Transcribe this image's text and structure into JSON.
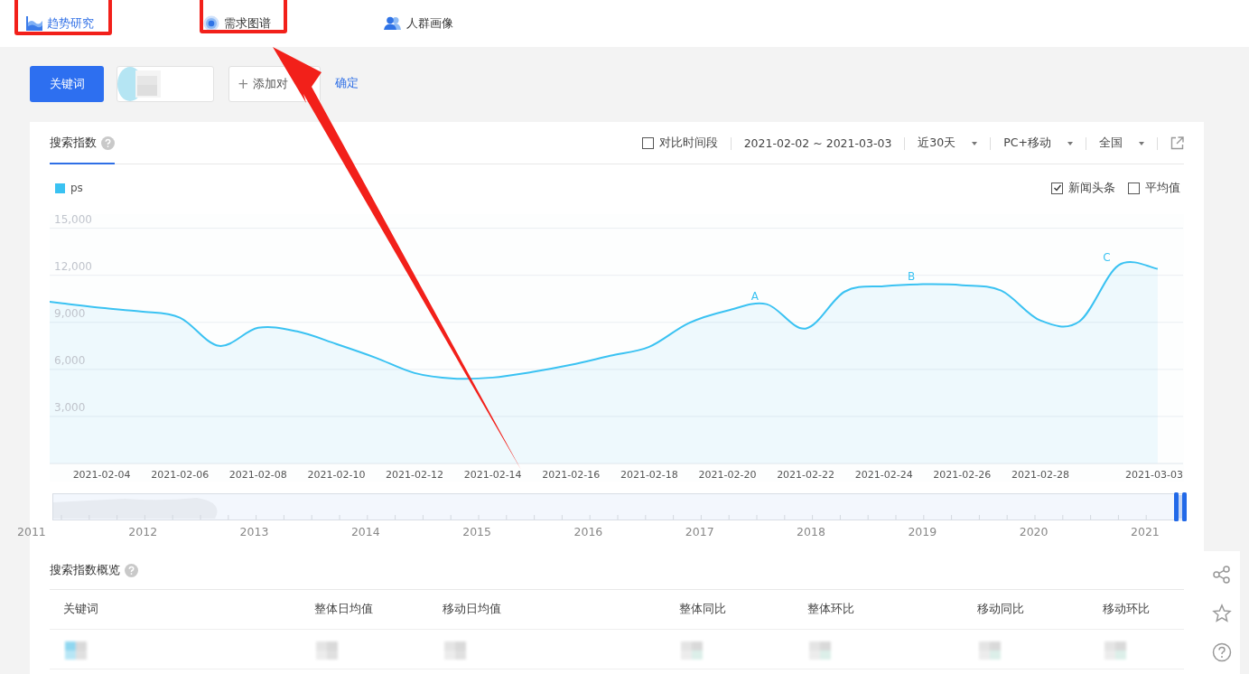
{
  "nav_tabs": [
    {
      "label": "趋势研究",
      "kind": "wave",
      "selected": true,
      "highlighted": true
    },
    {
      "label": "需求图谱",
      "kind": "target",
      "selected": false,
      "highlighted": true
    },
    {
      "label": "人群画像",
      "kind": "people",
      "selected": false,
      "highlighted": false
    }
  ],
  "keyword_bar": {
    "keyword_button": "关键词",
    "add_plus": "+",
    "add_label": "添加对",
    "confirm": "确定"
  },
  "search_index": {
    "tab": "搜索指数",
    "compare_period": {
      "label": "对比时间段",
      "checked": false
    },
    "date_range": "2021-02-02 ~ 2021-03-03",
    "filters": [
      {
        "label": "近30天"
      },
      {
        "label": "PC+移动"
      },
      {
        "label": "全国"
      }
    ],
    "options": [
      {
        "label": "新闻头条",
        "checked": true
      },
      {
        "label": "平均值",
        "checked": false
      }
    ],
    "chart_data": {
      "type": "area",
      "grid": true,
      "categories": [
        null,
        null,
        "2021-02-04",
        null,
        "2021-02-06",
        null,
        "2021-02-08",
        null,
        "2021-02-10",
        null,
        "2021-02-12",
        null,
        "2021-02-14",
        null,
        "2021-02-16",
        null,
        "2021-02-18",
        null,
        "2021-02-20",
        null,
        "2021-02-22",
        null,
        "2021-02-24",
        null,
        "2021-02-26",
        null,
        "2021-02-28",
        null,
        null,
        "2021-03-03"
      ],
      "series": [
        {
          "name": "ps",
          "color": "#3ac2f2",
          "values": [
            10500,
            10210,
            9920,
            9690,
            9300,
            7500,
            8650,
            8420,
            7620,
            6750,
            5770,
            5420,
            5480,
            5830,
            6290,
            6870,
            7440,
            8940,
            9750,
            10160,
            8600,
            10960,
            11310,
            11430,
            11370,
            11020,
            9120,
            9060,
            12640,
            12410
          ]
        }
      ],
      "ylim": [
        0,
        15900
      ],
      "yticks": [
        {
          "value": 3000,
          "label": "3,000"
        },
        {
          "value": 6000,
          "label": "6,000"
        },
        {
          "value": 9000,
          "label": "9,000"
        },
        {
          "value": 12000,
          "label": "12,000"
        },
        {
          "value": 15000,
          "label": "15,000"
        }
      ],
      "annotations": [
        "A",
        "B",
        "C"
      ]
    },
    "navigator_years": [
      "2011",
      "2012",
      "2013",
      "2014",
      "2015",
      "2016",
      "2017",
      "2018",
      "2019",
      "2020",
      "2021"
    ]
  },
  "overview": {
    "title": "搜索指数概览",
    "columns": [
      "关键词",
      "整体日均值",
      "移动日均值",
      "整体同比",
      "整体环比",
      "移动同比",
      "移动环比"
    ]
  }
}
